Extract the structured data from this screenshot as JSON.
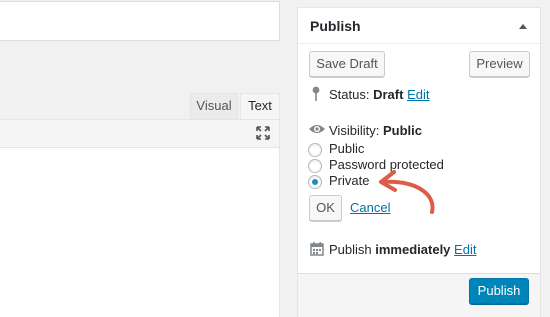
{
  "editor": {
    "tabs": [
      {
        "label": "Visual"
      },
      {
        "label": "Text"
      }
    ]
  },
  "publish_box": {
    "title": "Publish",
    "save_draft_label": "Save Draft",
    "preview_label": "Preview",
    "status_label": "Status:",
    "status_value": "Draft",
    "status_edit_link": "Edit",
    "visibility_label": "Visibility:",
    "visibility_value": "Public",
    "visibility_options": [
      {
        "label": "Public",
        "checked": false
      },
      {
        "label": "Password protected",
        "checked": false
      },
      {
        "label": "Private",
        "checked": true
      }
    ],
    "ok_label": "OK",
    "cancel_label": "Cancel",
    "publish_label": "Publish",
    "publish_timing": "immediately",
    "publish_edit_link": "Edit",
    "publish_button_label": "Publish"
  },
  "colors": {
    "accent_blue": "#0085ba",
    "link_blue": "#0073aa",
    "annotation_arrow": "#dd5b48"
  },
  "icons": [
    "expand-icon",
    "collapse-arrow-icon",
    "pin-icon",
    "eye-icon",
    "calendar-icon"
  ]
}
